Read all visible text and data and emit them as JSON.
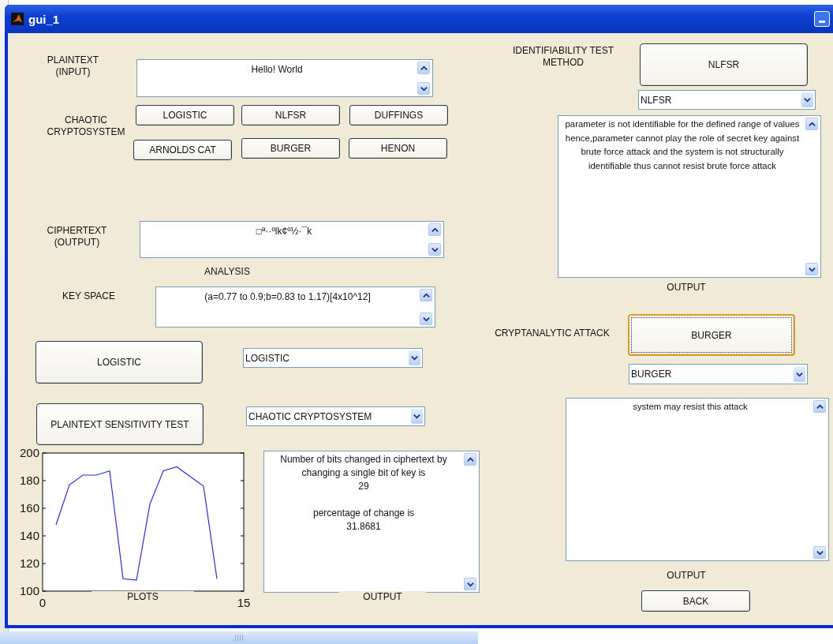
{
  "window": {
    "title": "gui_1"
  },
  "plaintext": {
    "label": "PLAINTEXT\n(INPUT)",
    "value": "Hello! World"
  },
  "cryptosystem": {
    "label": "CHAOTIC\nCRYPTOSYSTEM",
    "buttons": [
      "LOGISTIC",
      "NLFSR",
      "DUFFINGS",
      "ARNOLDS CAT",
      "BURGER",
      "HENON"
    ]
  },
  "ciphertext": {
    "label": "CIPHERTEXT\n(OUTPUT)",
    "value": "□ª··ºlk¢º½·¯k"
  },
  "analysis": {
    "heading": "ANALYSIS",
    "key_space_label": "KEY SPACE",
    "key_space_value": "(a=0.77 to 0.9;b=0.83 to 1.17)[4x10^12]"
  },
  "analysis_actions": [
    {
      "button": "LOGISTIC",
      "dropdown": "LOGISTIC"
    },
    {
      "button": "PLAINTEXT SENSITIVITY TEST",
      "dropdown": "CHAOTIC CRYPTOSYSTEM"
    }
  ],
  "plot": {
    "chart_data": {
      "type": "line",
      "xlabel": "PLOTS",
      "x": [
        1,
        2,
        3,
        4,
        5,
        6,
        7,
        8,
        9,
        10,
        11,
        12,
        13
      ],
      "series": [
        {
          "color": "#2b2bd6",
          "values": [
            148,
            177,
            184,
            184,
            187,
            109,
            108,
            163,
            187,
            190,
            183,
            176,
            109
          ]
        }
      ],
      "xlim": [
        0,
        15
      ],
      "ylim": [
        100,
        200
      ],
      "xticks": [
        0,
        15
      ],
      "yticks": [
        100,
        120,
        140,
        160,
        180,
        200
      ]
    }
  },
  "result": {
    "text": "Number of bits changed in ciphertext by\nchanging a single bit of key is\n29\n\npercentage of change is\n31.8681",
    "caption": "OUTPUT"
  },
  "identifiability": {
    "label": "IDENTIFIABILITY TEST\nMETHOD",
    "button": "NLFSR",
    "focused": false,
    "dropdown": "NLFSR",
    "output": "parameter is not identifiable for the defined range of values hence,parameter cannot play the role of secret key against brute force attack and the system is not structurally identifiable thus cannot resist brute force attack",
    "caption": "OUTPUT"
  },
  "attack": {
    "label": "CRYPTANALYTIC ATTACK",
    "button": "BURGER",
    "focused": true,
    "dropdown": "BURGER",
    "output": "system may resist this attack",
    "caption": "OUTPUT"
  },
  "back_button": "BACK"
}
